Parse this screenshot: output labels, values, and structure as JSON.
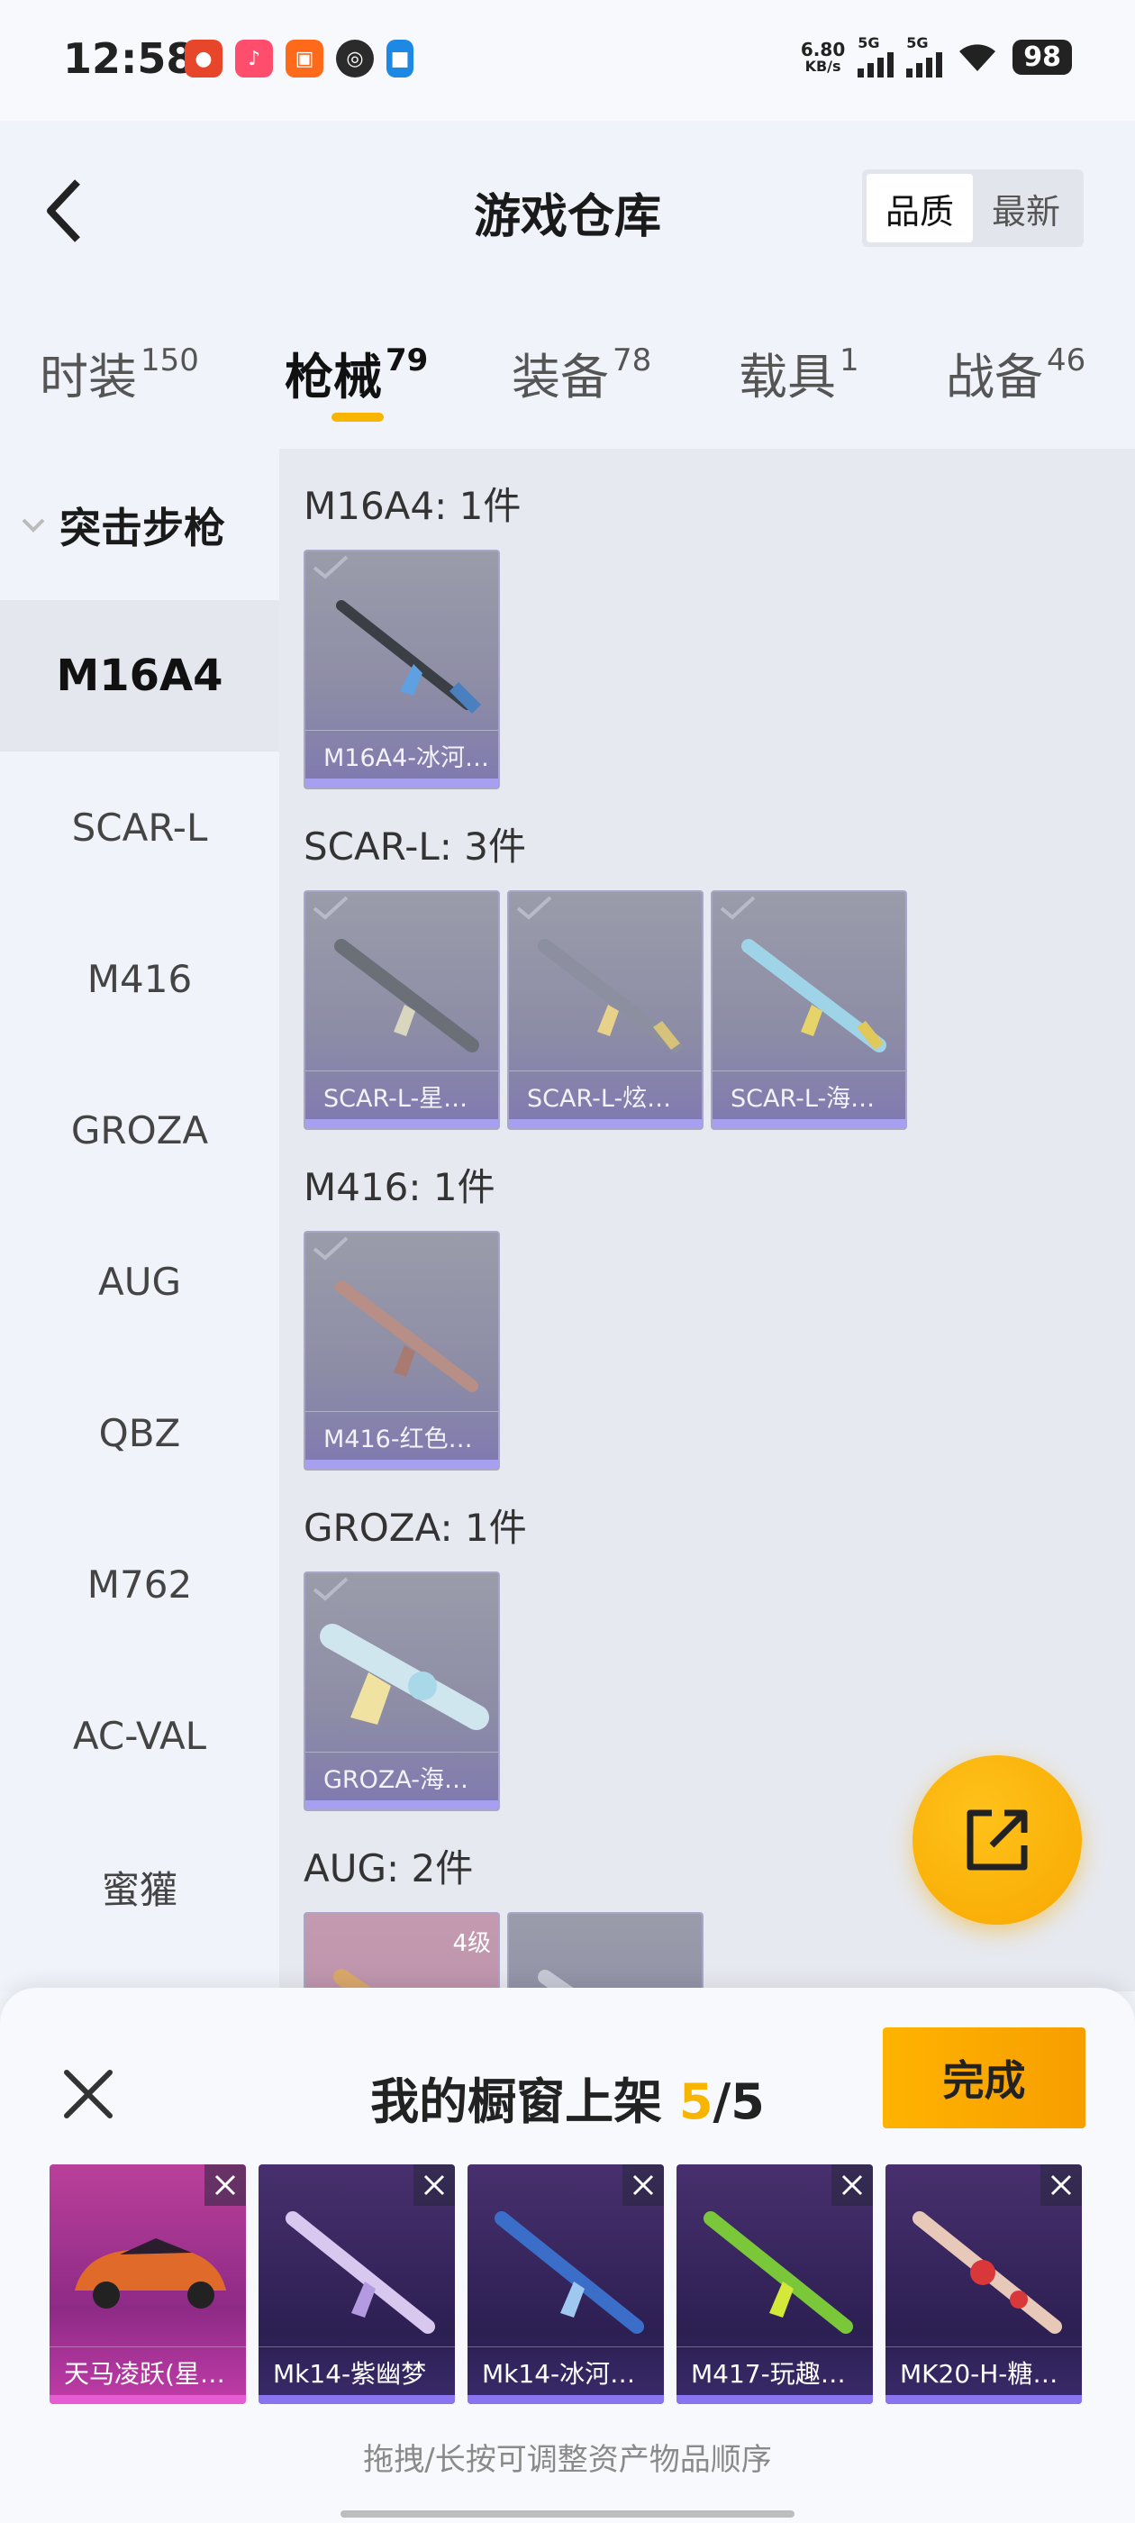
{
  "status_bar": {
    "time": "12:58",
    "net_speed_value": "6.80",
    "net_speed_unit": "KB/s",
    "sim1": "5G",
    "sim2": "5G",
    "battery": "98"
  },
  "header": {
    "title": "游戏仓库",
    "sort_options": [
      "品质",
      "最新"
    ],
    "sort_selected": "品质"
  },
  "tabs": [
    {
      "label": "时装",
      "count": "150"
    },
    {
      "label": "枪械",
      "count": "79",
      "active": true
    },
    {
      "label": "装备",
      "count": "78"
    },
    {
      "label": "载具",
      "count": "1"
    },
    {
      "label": "战备",
      "count": "46"
    }
  ],
  "sidebar": {
    "category": "突击步枪",
    "items": [
      "M16A4",
      "SCAR-L",
      "M416",
      "GROZA",
      "AUG",
      "QBZ",
      "M762",
      "AC-VAL",
      "蜜獾"
    ],
    "selected": "M16A4"
  },
  "groups": [
    {
      "title": "M16A4: 1件",
      "items": [
        {
          "name": "M16A4-冰河…"
        }
      ]
    },
    {
      "title": "SCAR-L: 3件",
      "items": [
        {
          "name": "SCAR-L-星…"
        },
        {
          "name": "SCAR-L-炫…"
        },
        {
          "name": "SCAR-L-海…"
        }
      ]
    },
    {
      "title": "M416: 1件",
      "items": [
        {
          "name": "M416-红色…"
        }
      ]
    },
    {
      "title": "GROZA: 1件",
      "items": [
        {
          "name": "GROZA-海…"
        }
      ]
    },
    {
      "title": "AUG: 2件",
      "items": [
        {
          "name": "",
          "badge": "4级"
        },
        {
          "name": ""
        }
      ]
    }
  ],
  "sheet": {
    "title_prefix": "我的橱窗上架",
    "count_current": "5",
    "count_sep": "/",
    "count_total": "5",
    "done_label": "完成",
    "items": [
      "天马凌跃(星…",
      "Mk14-紫幽梦",
      "Mk14-冰河…",
      "M417-玩趣…",
      "MK20-H-糖…"
    ],
    "hint": "拖拽/长按可调整资产物品顺序"
  },
  "colors": {
    "accent": "#f7b500",
    "card_purple": "#8d8ca6",
    "shelf_dark": "#2c1f52",
    "shelf_pink": "#b9409a"
  }
}
